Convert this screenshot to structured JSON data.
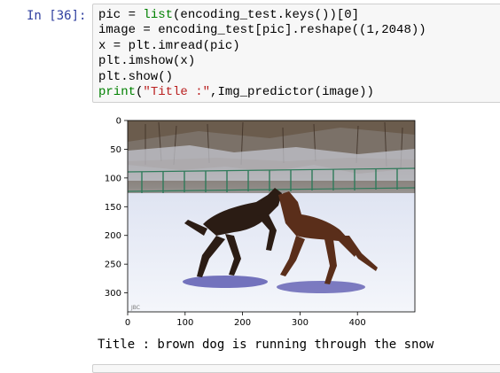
{
  "cell": {
    "prompt": "In [36]:",
    "code_lines": [
      [
        {
          "t": "pic = "
        },
        {
          "t": "list",
          "c": "builtin"
        },
        {
          "t": "(encoding_test.keys())[0]"
        }
      ],
      [
        {
          "t": "image = encoding_test[pic].reshape((1,2048))"
        }
      ],
      [
        {
          "t": "x = plt.imread(pic)"
        }
      ],
      [
        {
          "t": "plt.imshow(x)"
        }
      ],
      [
        {
          "t": "plt.show()"
        }
      ],
      [
        {
          "t": "print",
          "c": "builtin"
        },
        {
          "t": "("
        },
        {
          "t": "\"Title :\"",
          "c": "str"
        },
        {
          "t": ",Img_predictor(image))"
        }
      ]
    ]
  },
  "output": {
    "title_text": "Title : brown dog is running through the snow",
    "image_description": "two brown dobermans playing in the snow"
  },
  "plot": {
    "y_ticks": [
      "0",
      "50",
      "100",
      "150",
      "200",
      "250",
      "300"
    ],
    "x_ticks": [
      "0",
      "100",
      "200",
      "300",
      "400"
    ],
    "image_extent": {
      "width": 500,
      "height": 333
    }
  },
  "colors": {
    "prompt": "#303f9f",
    "builtin": "#008000",
    "string": "#ba2121",
    "cell_bg": "#f7f7f7",
    "cell_border": "#cfcfcf"
  }
}
